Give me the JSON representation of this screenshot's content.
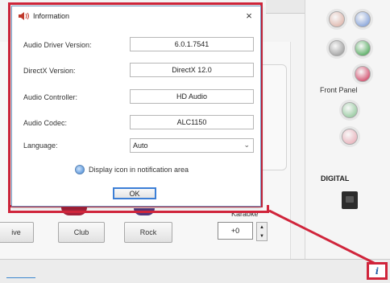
{
  "dialog": {
    "title": "Information",
    "close_label": "×",
    "rows": [
      {
        "label": "Audio Driver Version:",
        "value": "6.0.1.7541"
      },
      {
        "label": "DirectX Version:",
        "value": "DirectX 12.0"
      },
      {
        "label": "Audio Controller:",
        "value": "HD Audio"
      },
      {
        "label": "Audio Codec:",
        "value": "ALC1150"
      }
    ],
    "language_label": "Language:",
    "language_value": "Auto",
    "display_icon_label": "Display icon in notification area",
    "ok_label": "OK"
  },
  "background": {
    "eq_buttons": [
      "ive",
      "Club",
      "Rock"
    ],
    "karaoke_label": "Karaoke",
    "karaoke_value": "+0"
  },
  "right_panel": {
    "front_panel_label": "Front Panel",
    "digital_label": "DIGITAL",
    "jack_colors": [
      "#d9a79a",
      "#6b8fd3",
      "#8c8c8c",
      "#2f9a3c",
      "#c9244a",
      "#7fbf8a",
      "#e5a2ad"
    ]
  },
  "status_bar": {
    "info_icon": "info-icon"
  },
  "colors": {
    "highlight": "#d0253b",
    "accent": "#3c7fd6"
  }
}
